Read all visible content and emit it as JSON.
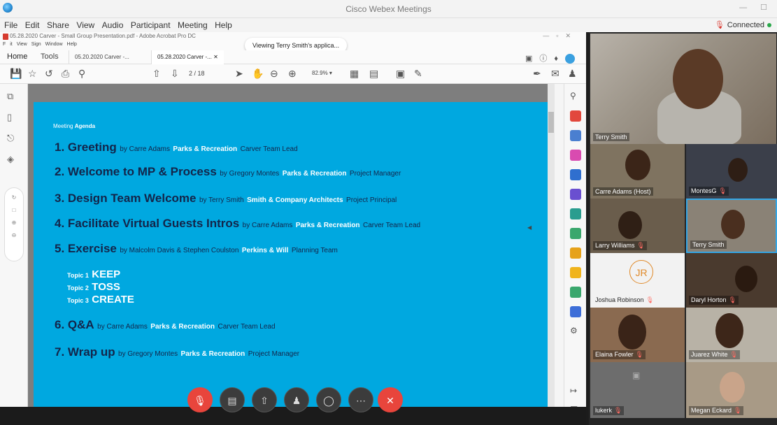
{
  "window": {
    "title": "Cisco Webex Meetings",
    "controls": "— ☐"
  },
  "menu": {
    "items": [
      "File",
      "Edit",
      "Share",
      "View",
      "Audio",
      "Participant",
      "Meeting",
      "Help"
    ],
    "connection": "Connected"
  },
  "acrobat": {
    "window_title": "05.28.2020 Carver - Small Group Presentation.pdf - Adobe Acrobat Pro DC",
    "menu": [
      "F",
      "it",
      "View",
      "Sign",
      "Window",
      "Help"
    ],
    "viewing_banner": "Viewing Terry Smith's applica...",
    "home": "Home",
    "tools": "Tools",
    "tabs": [
      "05.20.2020 Carver -...",
      "05.28.2020 Carver -..."
    ],
    "page_current": "2",
    "page_total": "/ 18",
    "zoom": "82.9%"
  },
  "agenda": {
    "header_pre": "Meeting ",
    "header_bold": "Agenda",
    "items": [
      {
        "title": "1. Greeting",
        "by": "by Carre Adams",
        "org": "Parks & Recreation",
        "role": "Carver Team Lead"
      },
      {
        "title": "2. Welcome to MP & Process",
        "by": "by Gregory Montes",
        "org": "Parks & Recreation",
        "role": "Project Manager"
      },
      {
        "title": "3. Design Team Welcome",
        "by": "by Terry Smith",
        "org": "Smith & Company Architects",
        "role": "Project Principal"
      },
      {
        "title": "4. Facilitate Virtual Guests Intros",
        "by": "by Carre Adams",
        "org": "Parks & Recreation",
        "role": "Carver Team Lead"
      },
      {
        "title": "5. Exercise",
        "by": "by Malcolm Davis & Stephen Coulston",
        "org": "Perkins & Will",
        "role": "Planning Team"
      },
      {
        "title": "6. Q&A",
        "by": "by Carre Adams",
        "org": "Parks & Recreation",
        "role": "Carver Team Lead"
      },
      {
        "title": "7. Wrap up",
        "by": "by Gregory Montes",
        "org": "Parks & Recreation",
        "role": "Project Manager"
      }
    ],
    "topics": [
      {
        "label": "Topic 1",
        "value": "KEEP"
      },
      {
        "label": "Topic 2",
        "value": "TOSS"
      },
      {
        "label": "Topic 3",
        "value": "CREATE"
      }
    ]
  },
  "participants": [
    {
      "name": "Terry Smith"
    },
    {
      "name": "Carre Adams (Host)"
    },
    {
      "name": "MontesG"
    },
    {
      "name": "Larry Williams"
    },
    {
      "name": "Terry Smith"
    },
    {
      "name": "Joshua Robinson",
      "initials": "JR"
    },
    {
      "name": "Daryl Horton"
    },
    {
      "name": "Elaina Fowler"
    },
    {
      "name": "Juarez White"
    },
    {
      "name": "lukerk"
    },
    {
      "name": "Megan Eckard"
    }
  ],
  "colors": {
    "slide_blue": "#00a8e0",
    "navy_text": "#13254a",
    "end_red": "#e8453c",
    "selected_border": "#33a6e6"
  }
}
